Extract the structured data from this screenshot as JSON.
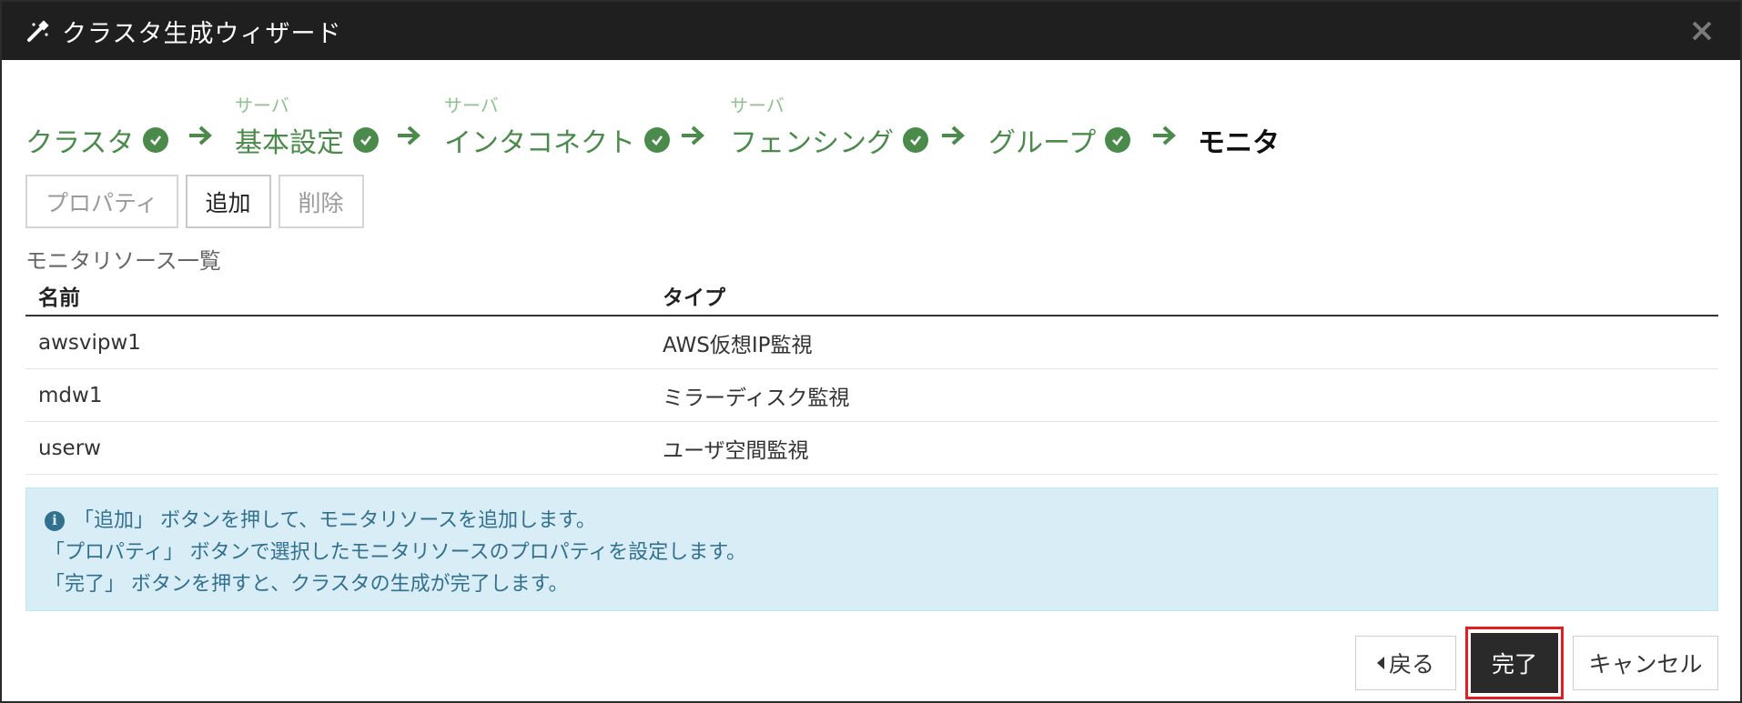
{
  "window": {
    "title": "クラスタ生成ウィザード",
    "title_icon": "magic-wand-icon",
    "close_icon": "close-icon"
  },
  "steps": [
    {
      "sub": "",
      "label": "クラスタ",
      "done": true
    },
    {
      "sub": "サーバ",
      "label": "基本設定",
      "done": true
    },
    {
      "sub": "サーバ",
      "label": "インタコネクト",
      "done": true
    },
    {
      "sub": "サーバ",
      "label": "フェンシング",
      "done": true
    },
    {
      "sub": "",
      "label": "グループ",
      "done": true
    },
    {
      "sub": "",
      "label": "モニタ",
      "done": false,
      "current": true
    }
  ],
  "toolbar": {
    "properties_label": "プロパティ",
    "add_label": "追加",
    "delete_label": "削除"
  },
  "list": {
    "title": "モニタリソース一覧",
    "columns": [
      "名前",
      "タイプ"
    ],
    "rows": [
      [
        "awsvipw1",
        "AWS仮想IP監視"
      ],
      [
        "mdw1",
        "ミラーディスク監視"
      ],
      [
        "userw",
        "ユーザ空間監視"
      ]
    ]
  },
  "info": {
    "icon": "info-icon",
    "lines": [
      "「追加」 ボタンを押して、モニタリソースを追加します。",
      "「プロパティ」 ボタンで選択したモニタリソースのプロパティを設定します。",
      "「完了」 ボタンを押すと、クラスタの生成が完了します。"
    ]
  },
  "footer": {
    "back_label": "戻る",
    "finish_label": "完了",
    "cancel_label": "キャンセル"
  },
  "colors": {
    "titlebar": "#1f1f1f",
    "step_done": "#4a8a4a",
    "step_sub": "#8fc08f",
    "info_bg": "#d9edf7",
    "highlight": "#e02020"
  }
}
